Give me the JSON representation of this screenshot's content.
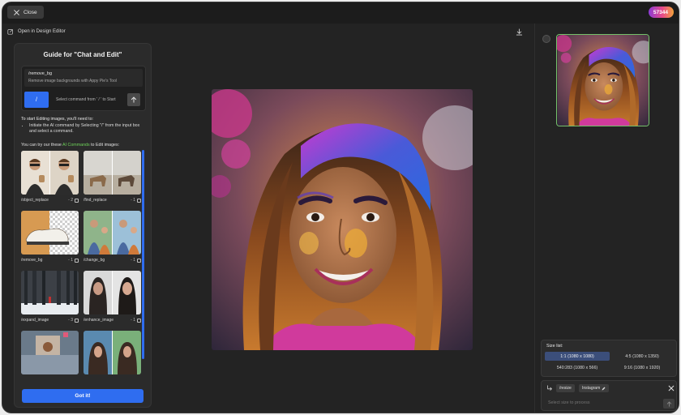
{
  "topbar": {
    "close_label": "Close",
    "credits": "57344"
  },
  "toolbar": {
    "design_editor_label": "Open in Design Editor"
  },
  "guide": {
    "title": "Guide for \"Chat and Edit\"",
    "command_name": "/remove_bg",
    "command_desc": "Remove image backgrounds with Appy Pie's Tool",
    "slash_label": "/",
    "input_hint": "Select command from ' / ' to Start",
    "intro_line": "To start Editing images, you'll need to:",
    "intro_bullet": "Initiate the AI command by Selecting \"/\" from the input box and select a command.",
    "ai_prefix": "You can try our these ",
    "ai_link": "AI Commands",
    "ai_suffix": " to Edit images:",
    "cards": [
      {
        "label": "/object_replace",
        "count": "- 2"
      },
      {
        "label": "/find_replace",
        "count": "- 1"
      },
      {
        "label": "/remove_bg",
        "count": "- 1"
      },
      {
        "label": "/change_bg",
        "count": "- 1"
      },
      {
        "label": "/expand_image",
        "count": "- 3"
      },
      {
        "label": "/enhance_image",
        "count": "- 1"
      },
      {
        "label": "",
        "count": ""
      },
      {
        "label": "",
        "count": ""
      }
    ],
    "got_it_label": "Got it!"
  },
  "size_panel": {
    "title": "Size list:",
    "options": [
      "1:1 (1080 x 1080)",
      "4:5 (1080 x 1350)",
      "540:283 (1080 x 566)",
      "9:16 (1080 x 1920)"
    ],
    "selected_index": 0
  },
  "input_panel": {
    "command_chip": "/resize",
    "preset_chip": "Instagram",
    "placeholder": "Select size to process"
  },
  "colors": {
    "accent": "#2f6df0",
    "green": "#6fd35a",
    "selected_size": "#3b4e7a"
  }
}
